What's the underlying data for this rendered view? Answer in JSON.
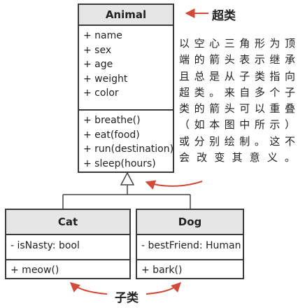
{
  "classes": {
    "animal": {
      "name": "Animal",
      "attributes": [
        "+ name",
        "+ sex",
        "+ age",
        "+ weight",
        "+ color"
      ],
      "operations": [
        "+ breathe()",
        "+ eat(food)",
        "+ run(destination)",
        "+ sleep(hours)"
      ]
    },
    "cat": {
      "name": "Cat",
      "attributes": [
        "- isNasty: bool"
      ],
      "operations": [
        "+ meow()"
      ]
    },
    "dog": {
      "name": "Dog",
      "attributes": [
        "- bestFriend: Human"
      ],
      "operations": [
        "+ bark()"
      ]
    }
  },
  "labels": {
    "superclass": "超类",
    "subclass": "子类"
  },
  "note": {
    "lines": [
      "以空心三角形为顶",
      "端的箭头表示继承",
      "且总是从子类指向",
      "超类。来自多个子",
      "类的箭头可以重叠",
      "（如本图中所示）",
      "或分别绘制。这不",
      "会改变其意义。"
    ]
  },
  "colors": {
    "border": "#3a3a3a",
    "header_fill": "#e6e6e6",
    "accent": "#d14a3a"
  }
}
